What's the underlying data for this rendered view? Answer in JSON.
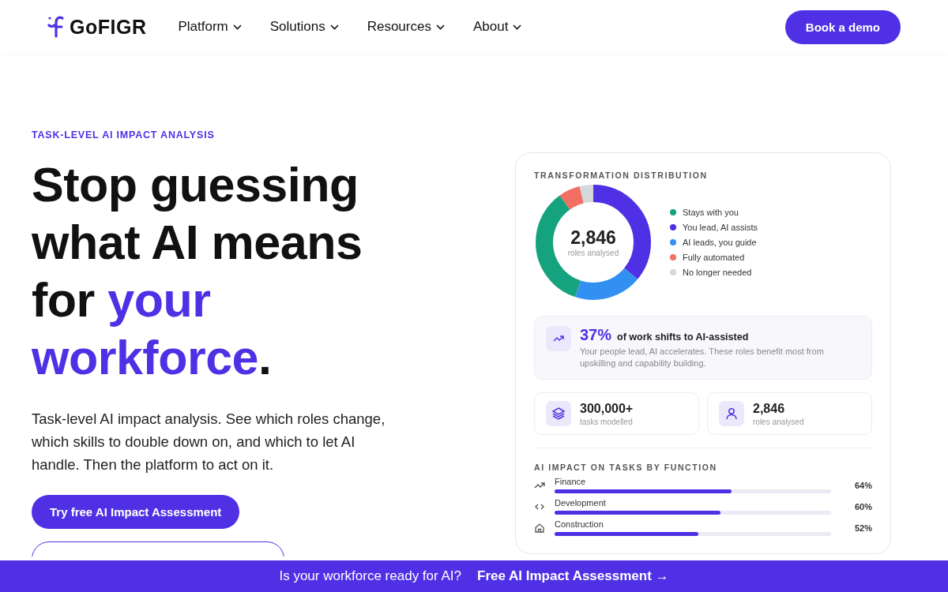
{
  "header": {
    "logo": "GoFIGR",
    "nav": [
      {
        "label": "Platform"
      },
      {
        "label": "Solutions"
      },
      {
        "label": "Resources"
      },
      {
        "label": "About"
      }
    ],
    "cta": "Book a demo"
  },
  "hero": {
    "eyebrow": "TASK-LEVEL AI IMPACT ANALYSIS",
    "headline": [
      {
        "text": "Stop guessing what AI means for ",
        "highlight": false
      },
      {
        "text": "your workforce",
        "highlight": true
      },
      {
        "text": ".",
        "highlight": false
      }
    ],
    "body": "Task-level AI impact analysis. See which roles change, which skills to double down on, and which to let AI handle. Then the platform to act on it.",
    "primary_button": "Try free AI Impact Assessment"
  },
  "card": {
    "title": "TRANSFORMATION DISTRIBUTION",
    "donut_total": "2,846",
    "donut_caption": "roles analysed",
    "legend": [
      {
        "label": "Stays with you",
        "color": "#15a37f"
      },
      {
        "label": "You lead, AI assists",
        "color": "#5030e5"
      },
      {
        "label": "AI leads, you guide",
        "color": "#3390f3"
      },
      {
        "label": "Fully automated",
        "color": "#f26f63"
      },
      {
        "label": "No longer needed",
        "color": "#d5d7db"
      }
    ],
    "insight": {
      "value": "37%",
      "headline": "of work shifts to AI-assisted",
      "text": "Your people lead, AI accelerates. These roles benefit most from upskilling and capability building."
    },
    "stats": [
      {
        "kind": "layers",
        "value": "300,000+",
        "caption": "tasks modelled"
      },
      {
        "kind": "person",
        "value": "2,846",
        "caption": "roles analysed"
      }
    ],
    "functions_title": "AI IMPACT ON TASKS BY FUNCTION",
    "functions": [
      {
        "kind": "trend",
        "name": "Finance",
        "level": 0.64,
        "reading": "64%"
      },
      {
        "kind": "code",
        "name": "Development",
        "level": 0.6,
        "reading": "60%"
      },
      {
        "kind": "house",
        "name": "Construction",
        "level": 0.52,
        "reading": "52%"
      }
    ]
  },
  "banner": {
    "text": "Is your workforce ready for AI?",
    "link": "Free AI Impact Assessment →"
  }
}
